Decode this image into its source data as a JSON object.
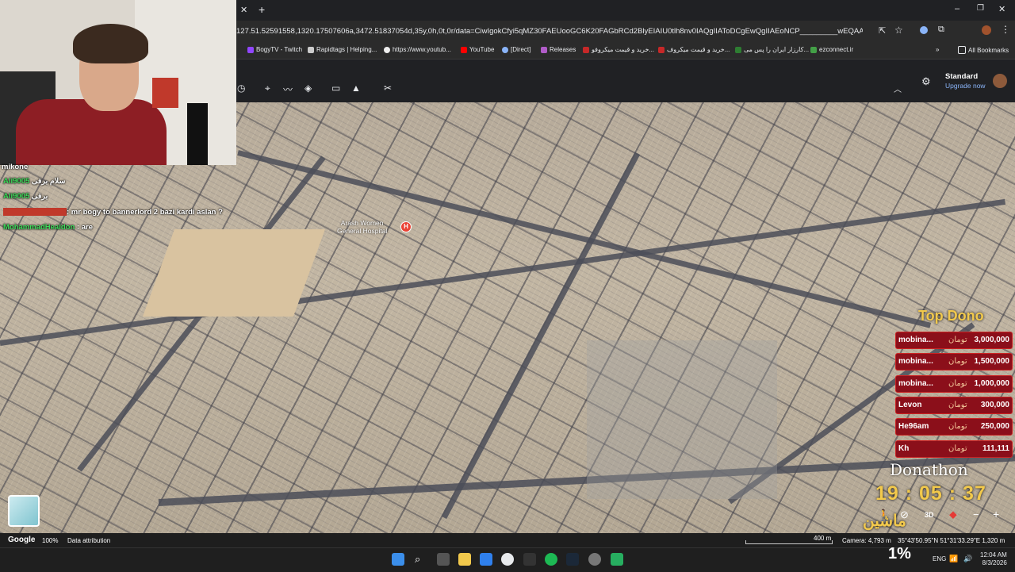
{
  "browser": {
    "url": "127.51.52591558,1320.17507606a,3472.51837054d,35y,0h,0t,0r/data=CiwIgokCfyi5qMZ30FAEUooGC6K20FAGbRCd2BlyEIAIU0tlh8nv0IAQgIIAToDCgEwQgIIAEoNCP_________wEQAA",
    "bookmarks": [
      "BogyTV - Twitch",
      "Rapidtags | Helping...",
      "https://www.youtub...",
      "YouTube",
      "[Direct]",
      "Releases",
      "خرید و قیمت میکروفو...",
      "خرید و قیمت میکروف...",
      "کارزار ایران را پس می...",
      "ezconnect.ir"
    ],
    "all_bookmarks": "All Bookmarks"
  },
  "earth": {
    "plan": "Standard",
    "upgrade": "Upgrade now",
    "place_label_1": "Arash Women",
    "place_label_2": "General Hospital",
    "attribution_logo": "Google",
    "zoom": "100%",
    "data_attribution": "Data attribution",
    "scale": "400 m",
    "camera": "Camera: 4,793 m",
    "coords": "35°43'50.95\"N 51°31'33.29\"E  1,320 m",
    "btn_3d": "3D"
  },
  "chat": [
    {
      "user": "mikone",
      "msg": ""
    },
    {
      "user": "Ali9005",
      "msg": "سلام برفی"
    },
    {
      "user": "Ali9005",
      "msg": "برفی"
    },
    {
      "user": "",
      "msg": ": mr bogy to bannerlord 2 bazi kardi aslan ?"
    },
    {
      "user": "MohammadHealdon",
      "msg": ": are"
    }
  ],
  "dono": {
    "title": "Top Dono",
    "currency": "تومان",
    "rows": [
      {
        "name": "mobina...",
        "amount": "3,000,000"
      },
      {
        "name": "mobina...",
        "amount": "1,500,000"
      },
      {
        "name": "mobina...",
        "amount": "1,000,000"
      },
      {
        "name": "Levon",
        "amount": "300,000"
      },
      {
        "name": "He96am",
        "amount": "250,000"
      },
      {
        "name": "Kh",
        "amount": "111,111"
      }
    ],
    "donathon": "Donathon",
    "timer": "19 : 05 : 37",
    "overlay_word": "ماشین",
    "percent": "1%"
  },
  "system": {
    "lang": "ENG",
    "time": "12:04 AM",
    "date": "8/3/2026"
  },
  "colors": {
    "dono_bg": "#8b0f1a",
    "timer": "#f2c94c",
    "chat_green": "#3ddc5a"
  }
}
